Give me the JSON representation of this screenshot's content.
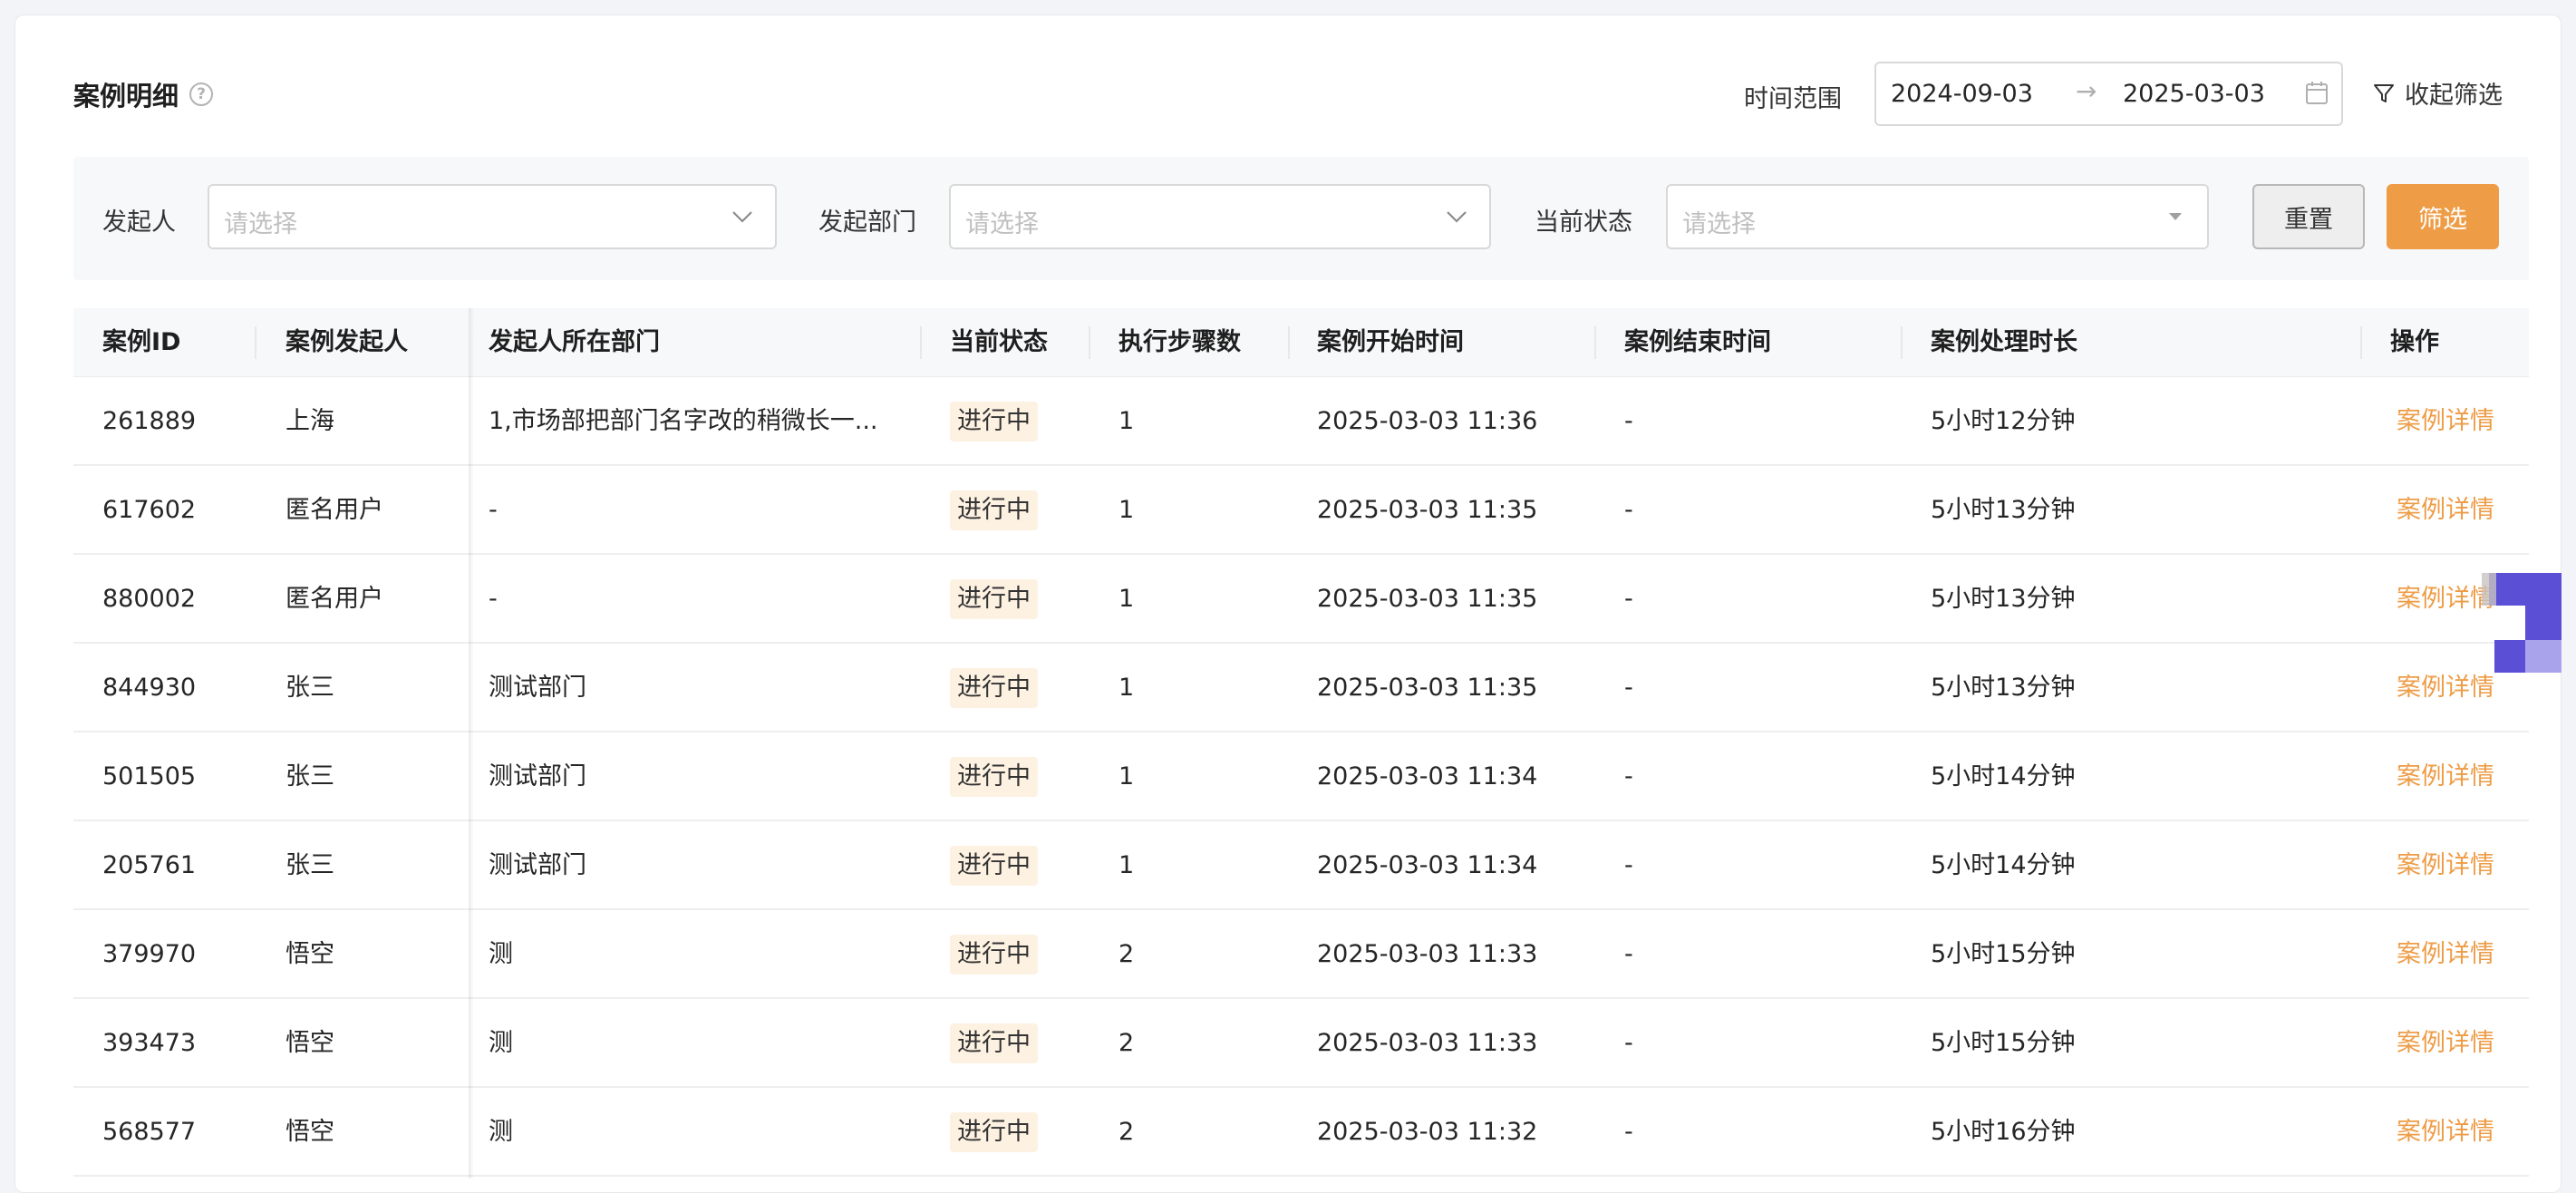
{
  "header": {
    "title": "案例明细",
    "help_icon": "question-circle-icon",
    "time_range_label": "时间范围",
    "date_start": "2024-09-03",
    "date_separator": "→",
    "date_end": "2025-03-03",
    "collapse_label": "收起筛选"
  },
  "filters": {
    "initiator_label": "发起人",
    "initiator_placeholder": "请选择",
    "department_label": "发起部门",
    "department_placeholder": "请选择",
    "status_label": "当前状态",
    "status_placeholder": "请选择",
    "reset_label": "重置",
    "filter_label": "筛选"
  },
  "table": {
    "columns": [
      "案例ID",
      "案例发起人",
      "发起人所在部门",
      "当前状态",
      "执行步骤数",
      "案例开始时间",
      "案例结束时间",
      "案例处理时长",
      "操作"
    ],
    "rows": [
      {
        "id": "261889",
        "initiator": "上海",
        "department": "1,市场部把部门名字改的稍微长一...",
        "status": "进行中",
        "steps": "1",
        "start": "2025-03-03 11:36",
        "end": "-",
        "duration": "5小时12分钟",
        "action": "案例详情"
      },
      {
        "id": "617602",
        "initiator": "匿名用户",
        "department": "-",
        "status": "进行中",
        "steps": "1",
        "start": "2025-03-03 11:35",
        "end": "-",
        "duration": "5小时13分钟",
        "action": "案例详情"
      },
      {
        "id": "880002",
        "initiator": "匿名用户",
        "department": "-",
        "status": "进行中",
        "steps": "1",
        "start": "2025-03-03 11:35",
        "end": "-",
        "duration": "5小时13分钟",
        "action": "案例详情"
      },
      {
        "id": "844930",
        "initiator": "张三",
        "department": "测试部门",
        "status": "进行中",
        "steps": "1",
        "start": "2025-03-03 11:35",
        "end": "-",
        "duration": "5小时13分钟",
        "action": "案例详情"
      },
      {
        "id": "501505",
        "initiator": "张三",
        "department": "测试部门",
        "status": "进行中",
        "steps": "1",
        "start": "2025-03-03 11:34",
        "end": "-",
        "duration": "5小时14分钟",
        "action": "案例详情"
      },
      {
        "id": "205761",
        "initiator": "张三",
        "department": "测试部门",
        "status": "进行中",
        "steps": "1",
        "start": "2025-03-03 11:34",
        "end": "-",
        "duration": "5小时14分钟",
        "action": "案例详情"
      },
      {
        "id": "379970",
        "initiator": "悟空",
        "department": "测",
        "status": "进行中",
        "steps": "2",
        "start": "2025-03-03 11:33",
        "end": "-",
        "duration": "5小时15分钟",
        "action": "案例详情"
      },
      {
        "id": "393473",
        "initiator": "悟空",
        "department": "测",
        "status": "进行中",
        "steps": "2",
        "start": "2025-03-03 11:33",
        "end": "-",
        "duration": "5小时15分钟",
        "action": "案例详情"
      },
      {
        "id": "568577",
        "initiator": "悟空",
        "department": "测",
        "status": "进行中",
        "steps": "2",
        "start": "2025-03-03 11:32",
        "end": "-",
        "duration": "5小时16分钟",
        "action": "案例详情"
      }
    ]
  },
  "colors": {
    "accent": "#ee9c46",
    "status_bg": "#fdf1e2",
    "widget": "#5b4fd6"
  }
}
